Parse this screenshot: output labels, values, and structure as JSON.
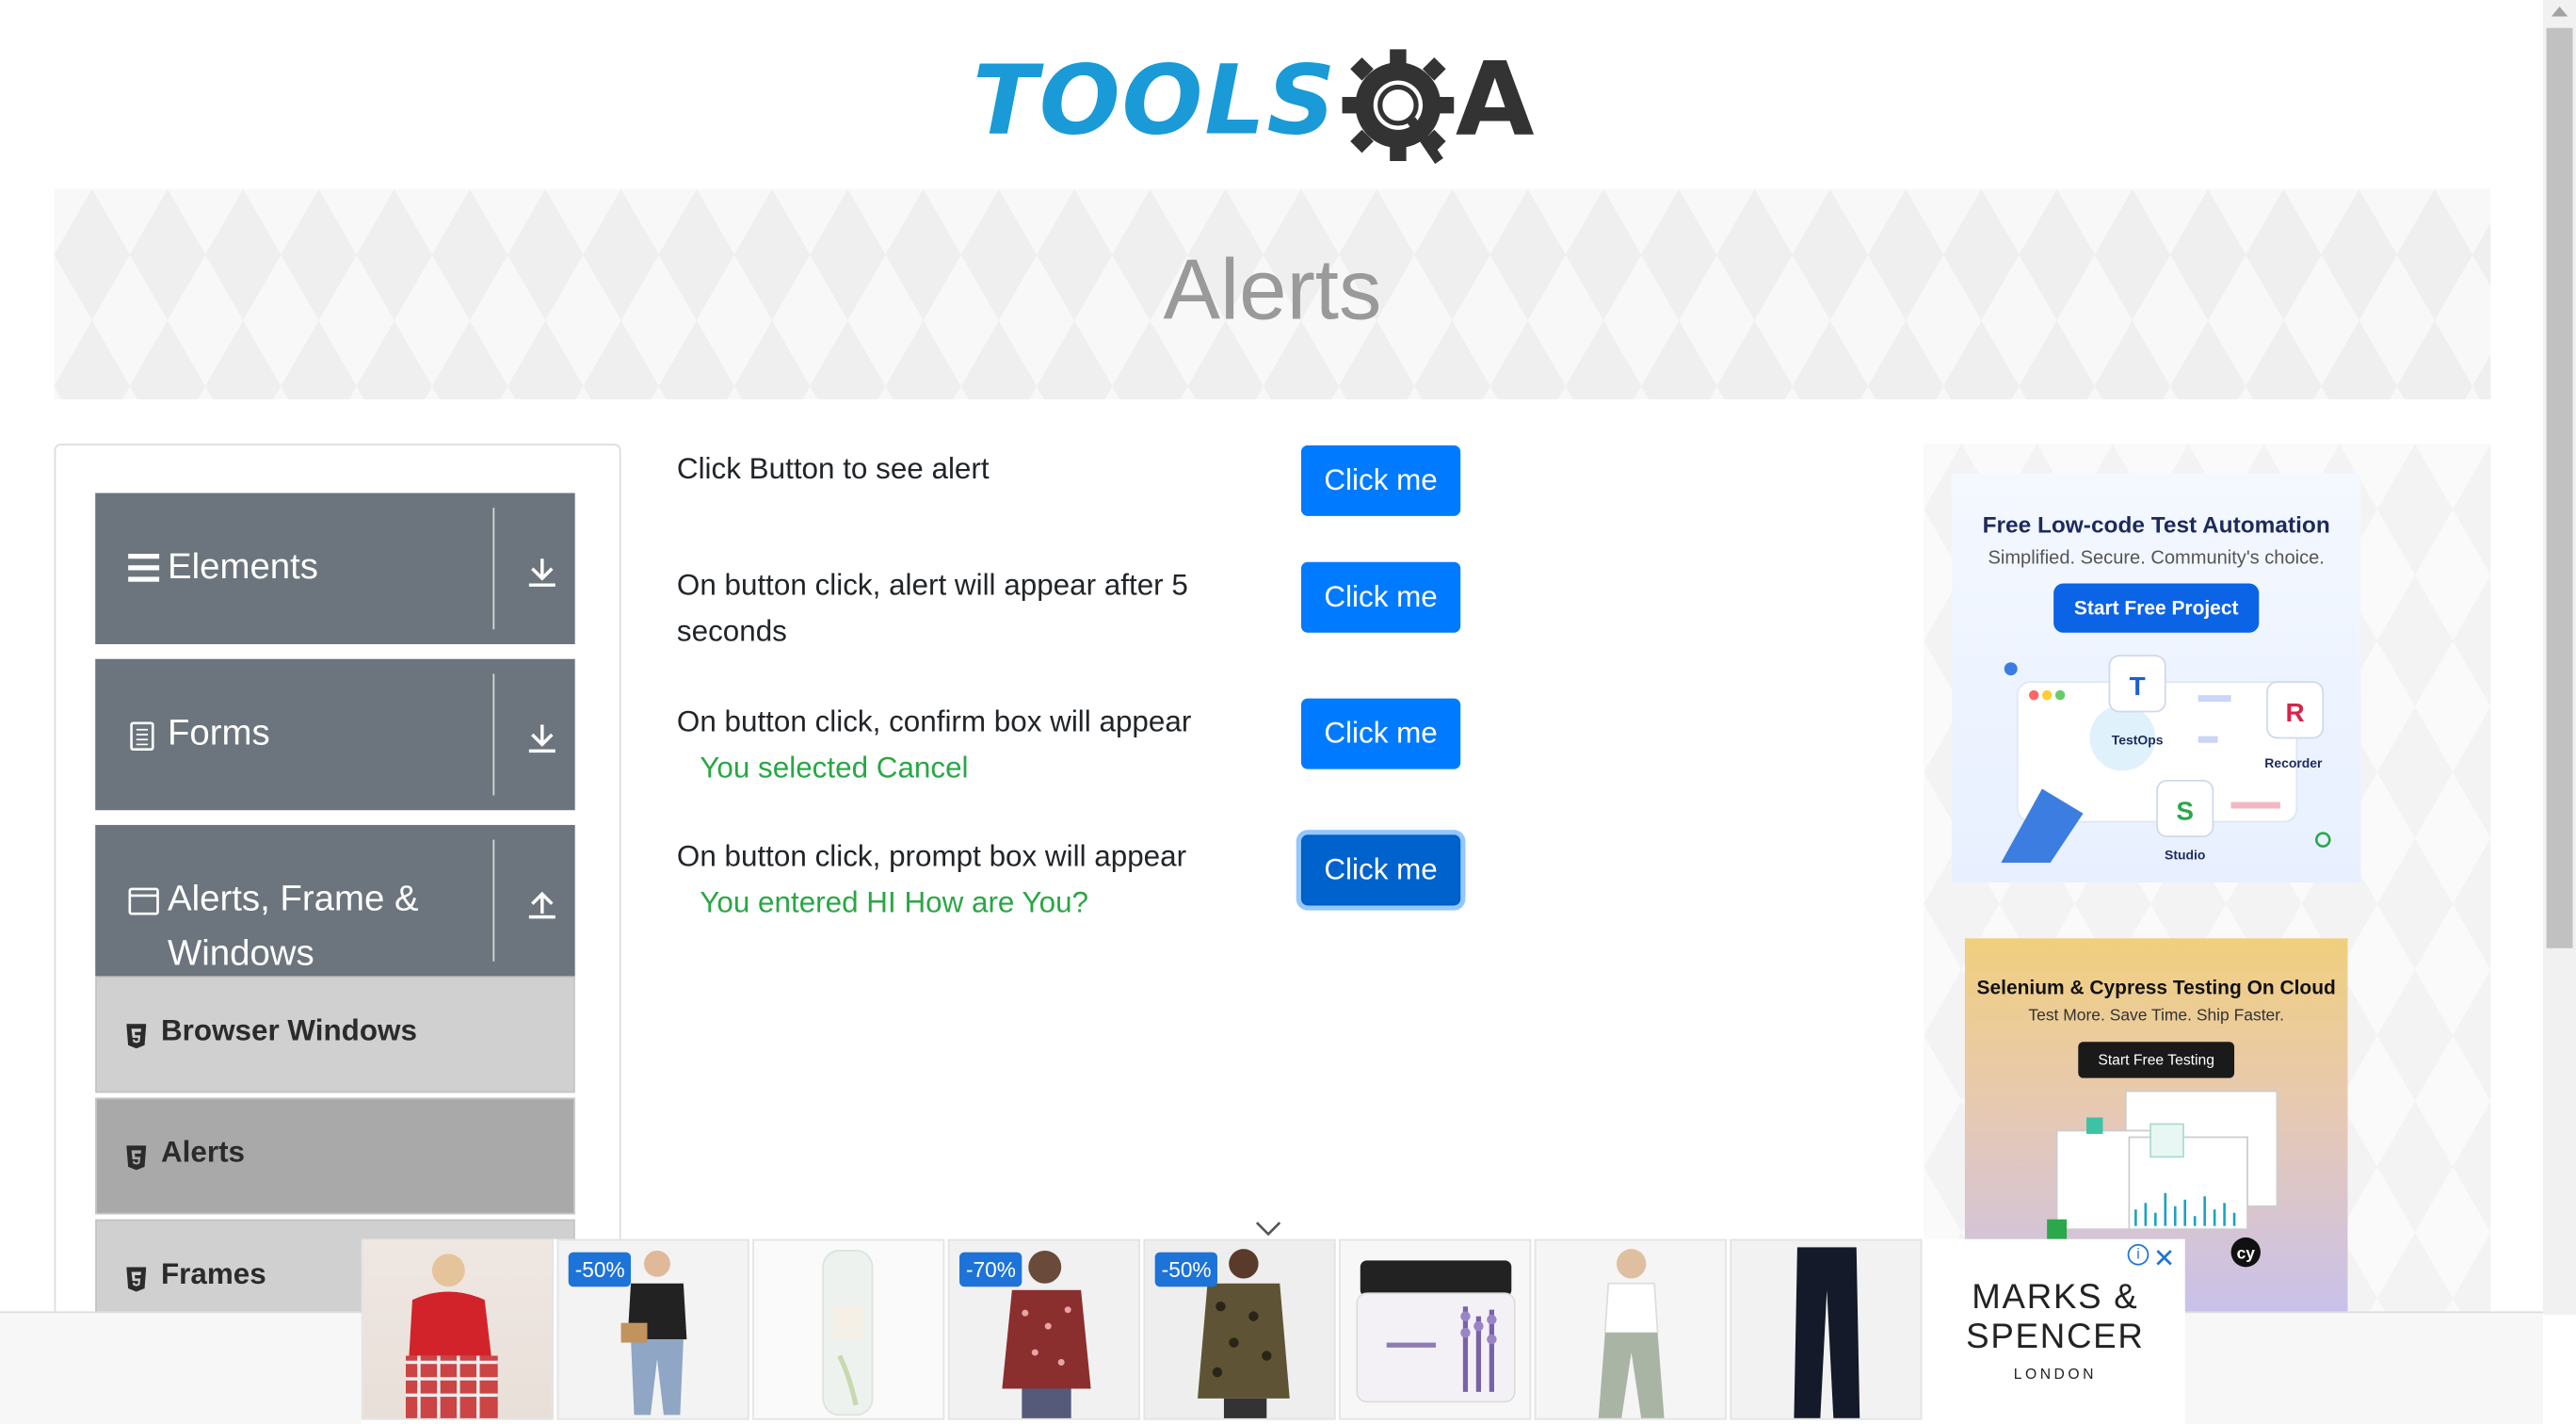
{
  "brand": {
    "logo_text": "TOOLS",
    "logo_suffix": "A"
  },
  "page_title": "Alerts",
  "sidebar": {
    "groups": [
      {
        "label": "Elements",
        "icon": "hamburger-icon",
        "arrow": "download-arrow-icon"
      },
      {
        "label": "Forms",
        "icon": "document-icon",
        "arrow": "download-arrow-icon"
      },
      {
        "label": "Alerts, Frame & Windows",
        "icon": "window-icon",
        "arrow": "upload-arrow-icon"
      }
    ],
    "items": [
      {
        "label": "Browser Windows"
      },
      {
        "label": "Alerts"
      },
      {
        "label": "Frames"
      }
    ]
  },
  "alerts": [
    {
      "text": "Click Button to see alert",
      "button": "Click me",
      "result": ""
    },
    {
      "text": "On button click, alert will appear after 5 seconds",
      "button": "Click me",
      "result": ""
    },
    {
      "text": "On button click, confirm box will appear",
      "button": "Click me",
      "result": "You selected Cancel"
    },
    {
      "text": "On button click, prompt box will appear",
      "button": "Click me",
      "result": "You entered HI How are You?"
    }
  ],
  "ads": {
    "ad1": {
      "title": "Free Low-code Test Automation",
      "subtitle": "Simplified. Secure. Community's choice.",
      "cta": "Start Free Project",
      "labels": [
        "TestOps",
        "Recorder",
        "Studio"
      ]
    },
    "ad2": {
      "title": "Selenium & Cypress Testing On Cloud",
      "subtitle": "Test More. Save Time. Ship Faster.",
      "cta": "Start Free Testing"
    },
    "bottom": {
      "discounts": [
        "-50%",
        "-70%",
        "-50%"
      ],
      "brand_line1": "MARKS &",
      "brand_line2": "SPENCER",
      "brand_line3": "LONDON"
    }
  },
  "colors": {
    "primary": "#007bff",
    "success": "#28a745",
    "sidebar_group": "#6c757d",
    "logo_blue": "#1a9ad6"
  }
}
